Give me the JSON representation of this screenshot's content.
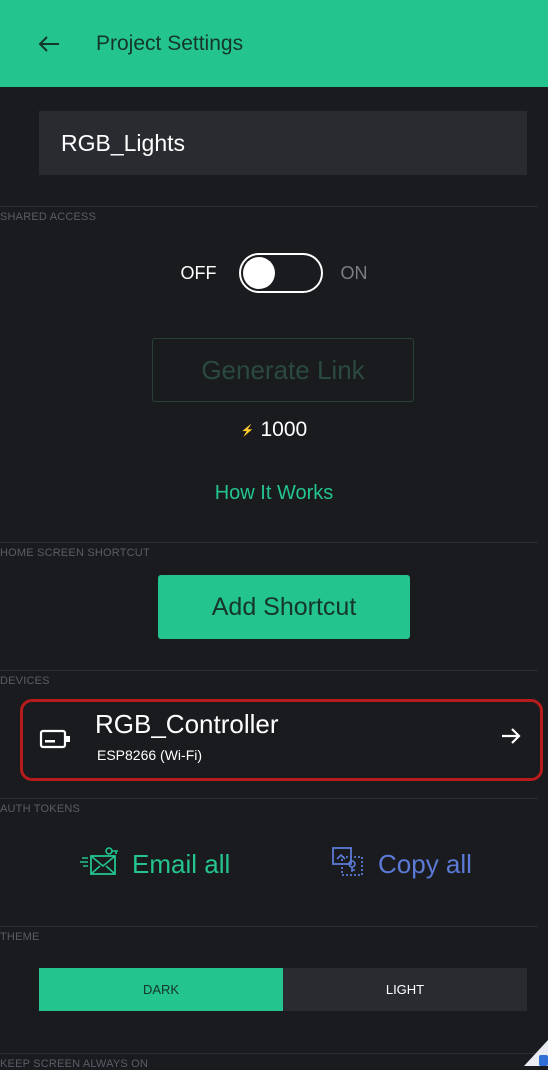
{
  "header": {
    "title": "Project Settings",
    "back_icon": "arrow-left-icon"
  },
  "project": {
    "name": "RGB_Lights"
  },
  "shared_access": {
    "section_label": "SHARED ACCESS",
    "toggle_off_label": "OFF",
    "toggle_on_label": "ON",
    "toggle_state": "off",
    "generate_link_label": "Generate Link",
    "energy_value": "1000",
    "energy_icon": "bolt-icon",
    "how_it_works_label": "How It Works"
  },
  "home_shortcut": {
    "section_label": "HOME SCREEN SHORTCUT",
    "add_label": "Add Shortcut"
  },
  "devices": {
    "section_label": "DEVICES",
    "items": [
      {
        "name": "RGB_Controller",
        "subtitle": "ESP8266 (Wi-Fi)",
        "icon": "device-board-icon",
        "arrow_icon": "arrow-right-icon"
      }
    ]
  },
  "auth_tokens": {
    "section_label": "AUTH TOKENS",
    "email_all_label": "Email all",
    "copy_all_label": "Copy all",
    "email_icon": "email-token-icon",
    "copy_icon": "copy-token-icon"
  },
  "theme": {
    "section_label": "THEME",
    "dark_label": "DARK",
    "light_label": "LIGHT",
    "selected": "DARK"
  },
  "keep_screen": {
    "section_label": "KEEP SCREEN ALWAYS ON"
  },
  "colors": {
    "accent": "#23c48e",
    "background": "#1a1b1f",
    "link_blue": "#5b7ad6",
    "highlight_red": "#b71c1c"
  }
}
